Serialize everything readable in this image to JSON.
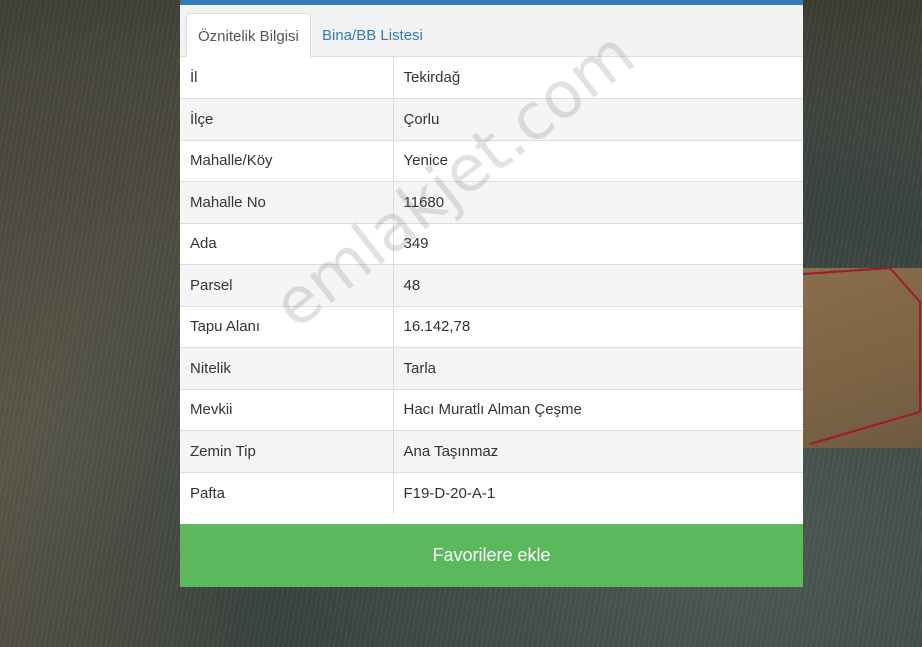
{
  "tabs": [
    {
      "label": "Öznitelik Bilgisi",
      "active": true
    },
    {
      "label": "Bina/BB Listesi",
      "active": false
    }
  ],
  "attributes": [
    {
      "key": "İl",
      "value": "Tekirdağ"
    },
    {
      "key": "İlçe",
      "value": "Çorlu"
    },
    {
      "key": "Mahalle/Köy",
      "value": "Yenice"
    },
    {
      "key": "Mahalle No",
      "value": "11680"
    },
    {
      "key": "Ada",
      "value": "349"
    },
    {
      "key": "Parsel",
      "value": "48"
    },
    {
      "key": "Tapu Alanı",
      "value": "16.142,78"
    },
    {
      "key": "Nitelik",
      "value": "Tarla"
    },
    {
      "key": "Mevkii",
      "value": "Hacı Muratlı Alman Çeşme"
    },
    {
      "key": "Zemin Tip",
      "value": "Ana Taşınmaz"
    },
    {
      "key": "Pafta",
      "value": "F19-D-20-A-1"
    }
  ],
  "favorite_button_label": "Favorilere ekle",
  "watermark": "emlakjet.com",
  "colors": {
    "accent_blue": "#337ab7",
    "button_green": "#5cb85c",
    "parcel_outline": "#a0182f"
  }
}
